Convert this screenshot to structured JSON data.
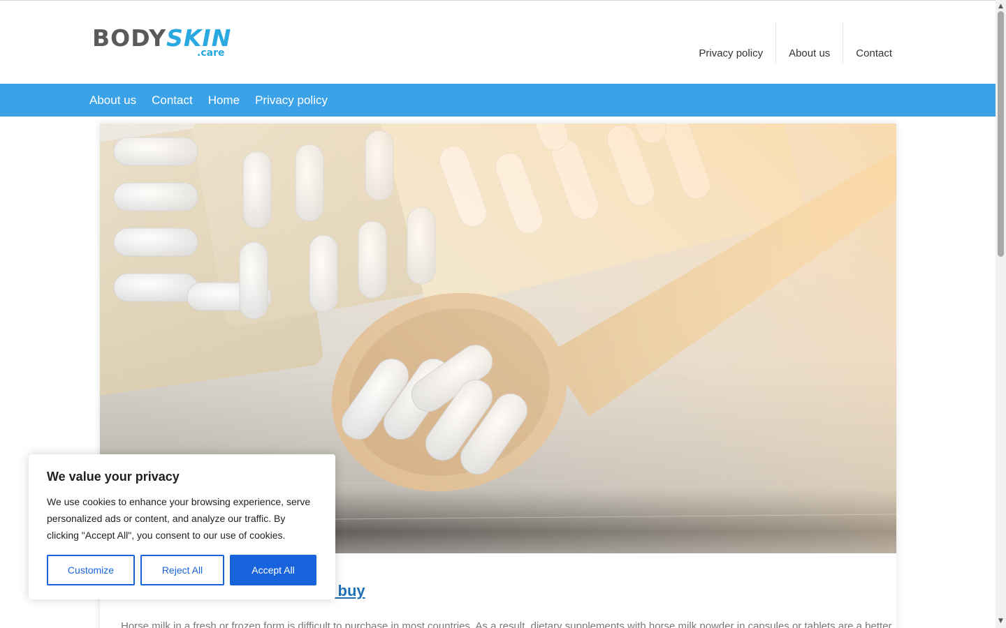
{
  "logo": {
    "brand_left": "BODY",
    "brand_right": "SKIN",
    "suffix": ".care"
  },
  "top_nav": {
    "items": [
      "Privacy policy",
      "About us",
      "Contact"
    ]
  },
  "menu": {
    "items": [
      "About us",
      "Contact",
      "Home",
      "Privacy policy"
    ]
  },
  "article": {
    "title_visible": "Benefits, usage and where to buy",
    "excerpt": "Horse milk in a fresh or frozen form is difficult to purchase in most countries. As a result, dietary supplements with horse milk powder in capsules or tablets are a better"
  },
  "cookie_banner": {
    "title": "We value your privacy",
    "text": "We use cookies to enhance your browsing experience, serve personalized ads or content, and analyze our traffic. By clicking \"Accept All\", you consent to our use of cookies.",
    "customize_label": "Customize",
    "reject_label": "Reject All",
    "accept_label": "Accept All"
  },
  "colors": {
    "menu_bar": "#3ba2e8",
    "brand_blue": "#2aa8e0",
    "link": "#1f6fb5",
    "consent_primary": "#1863dc"
  },
  "icons": {
    "scroll_up": "chevron-up-icon",
    "scroll_down": "chevron-down-icon"
  }
}
